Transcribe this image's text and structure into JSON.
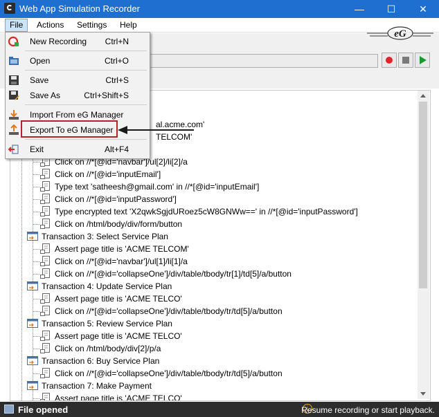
{
  "window": {
    "title": "Web App Simulation Recorder",
    "minimize": "—",
    "maximize": "☐",
    "close": "✕"
  },
  "menubar": {
    "items": [
      "File",
      "Actions",
      "Settings",
      "Help"
    ]
  },
  "file_menu": {
    "items": [
      {
        "label": "New Recording",
        "shortcut": "Ctrl+N",
        "icon": "new-recording-icon"
      },
      {
        "label": "Open",
        "shortcut": "Ctrl+O",
        "icon": "open-folder-icon"
      },
      {
        "label": "Save",
        "shortcut": "Ctrl+S",
        "icon": "save-icon"
      },
      {
        "label": "Save As",
        "shortcut": "Ctrl+Shift+S",
        "icon": "save-as-icon"
      },
      {
        "label": "Import From eG Manager",
        "shortcut": "",
        "icon": "import-icon"
      },
      {
        "label": "Export To eG Manager",
        "shortcut": "",
        "icon": "export-icon"
      },
      {
        "label": "Exit",
        "shortcut": "Alt+F4",
        "icon": "exit-icon"
      }
    ],
    "highlighted": "Export To eG Manager"
  },
  "tree": {
    "partial_rows": [
      {
        "text": "al.acme.com'"
      },
      {
        "text": "TELCOM'"
      }
    ],
    "rows": [
      {
        "type": "step",
        "text": "Click on //*[@id='navbar']/ul[2]/li[2]/a"
      },
      {
        "type": "step",
        "text": "Click on //*[@id='inputEmail']"
      },
      {
        "type": "step",
        "text": "Type text 'satheesh@gmail.com' in //*[@id='inputEmail']"
      },
      {
        "type": "step",
        "text": "Click on //*[@id='inputPassword']"
      },
      {
        "type": "step",
        "text": "Type encrypted text 'X2qwkSgjdURoez5cW8GNWw==' in //*[@id='inputPassword']"
      },
      {
        "type": "step",
        "text": "Click on /html/body/div/form/button"
      },
      {
        "type": "transaction",
        "text": "Transaction 3: Select Service Plan"
      },
      {
        "type": "step",
        "text": "Assert page title is 'ACME TELCOM'"
      },
      {
        "type": "step",
        "text": "Click on //*[@id='navbar']/ul[1]/li[1]/a"
      },
      {
        "type": "step",
        "text": "Click on //*[@id='collapseOne']/div/table/tbody/tr[1]/td[5]/a/button"
      },
      {
        "type": "transaction",
        "text": "Transaction 4: Update Service Plan"
      },
      {
        "type": "step",
        "text": "Assert page title is 'ACME TELCO'"
      },
      {
        "type": "step",
        "text": "Click on //*[@id='collapseOne']/div/table/tbody/tr/td[5]/a/button"
      },
      {
        "type": "transaction",
        "text": "Transaction 5: Review Service Plan"
      },
      {
        "type": "step",
        "text": "Assert page title is 'ACME TELCO'"
      },
      {
        "type": "step",
        "text": "Click on /html/body/div[2]/p/a"
      },
      {
        "type": "transaction",
        "text": "Transaction 6: Buy Service Plan"
      },
      {
        "type": "step",
        "text": "Click on //*[@id='collapseOne']/div/table/tbody/tr/td[5]/a/button"
      },
      {
        "type": "transaction",
        "text": "Transaction 7: Make Payment"
      },
      {
        "type": "step",
        "text": "Assert page title is 'ACME TELCO'"
      }
    ]
  },
  "statusbar": {
    "left": "File opened",
    "right": "Resume recording or start playback.",
    "info_icon": "i"
  },
  "colors": {
    "titlebar": "#1f6fd1",
    "highlight": "#b8202a",
    "record": "#e0242a",
    "play": "#1a9a2c",
    "statusbar": "#2d2d2d"
  },
  "logo_text": "eG"
}
